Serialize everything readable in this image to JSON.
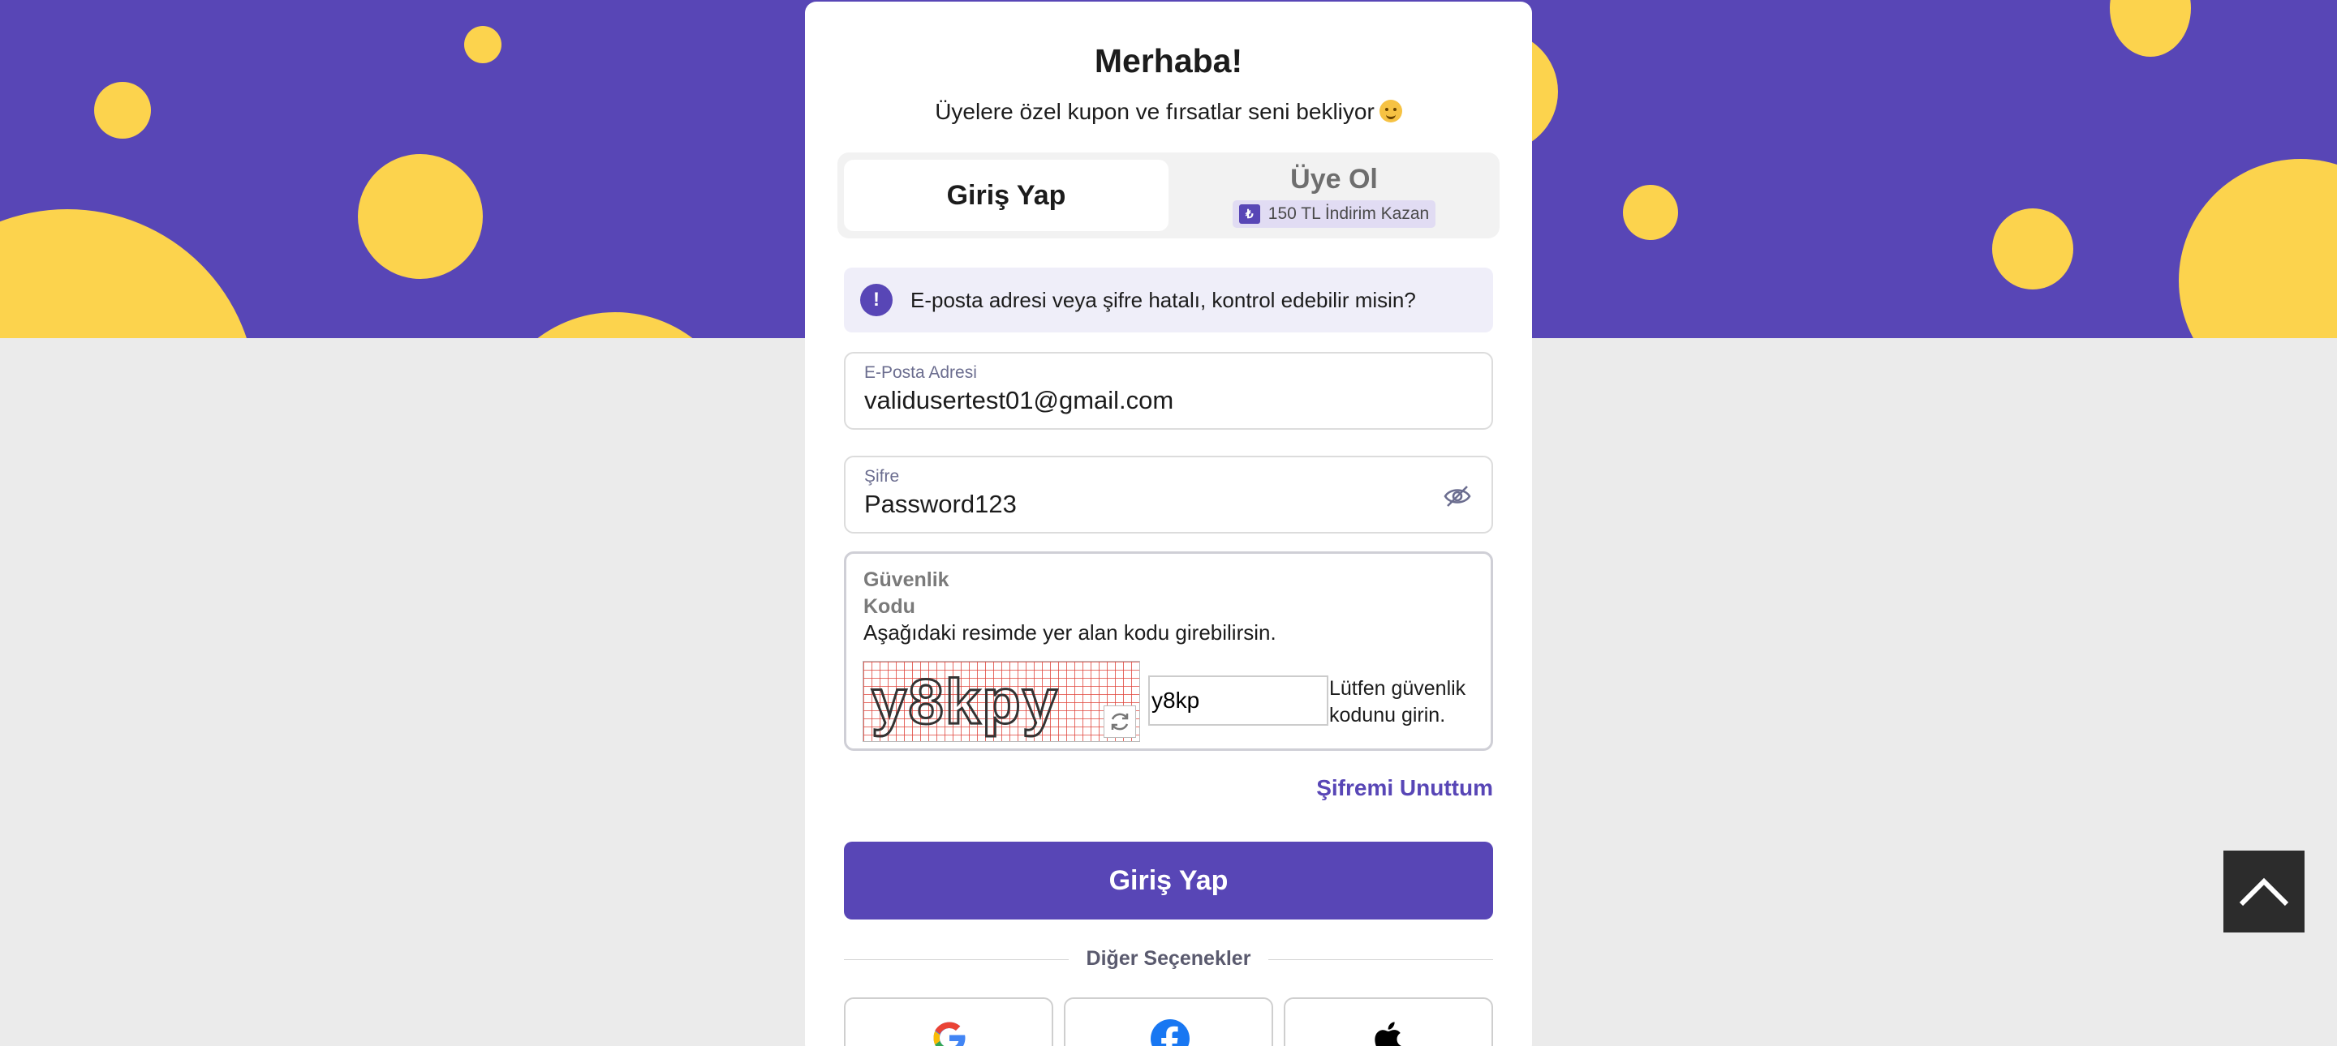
{
  "page": {
    "greeting": "Merhaba!",
    "subtitle": "Üyelere özel kupon ve fırsatlar seni bekliyor"
  },
  "tabs": {
    "login_label": "Giriş Yap",
    "signup_label": "Üye Ol",
    "signup_promo": "150 TL İndirim Kazan",
    "promo_icon_glyph": "₺",
    "active": "login"
  },
  "alert": {
    "icon_glyph": "!",
    "message": "E-posta adresi veya şifre hatalı, kontrol edebilir misin?"
  },
  "email_field": {
    "label": "E-Posta Adresi",
    "value": "validusertest01@gmail.com"
  },
  "password_field": {
    "label": "Şifre",
    "value": "Password123"
  },
  "security": {
    "label": "Güvenlik Kodu",
    "description": "Aşağıdaki resimde yer alan kodu girebilirsin.",
    "captcha_text": "y8kpy",
    "input_value": "y8kp",
    "hint": "Lütfen güvenlik kodunu girin."
  },
  "forgot_password": "Şifremi Unuttum",
  "submit_label": "Giriş Yap",
  "other_options": "Diğer Seçenekler",
  "social": [
    {
      "name": "google",
      "icon": "google-icon"
    },
    {
      "name": "facebook",
      "icon": "facebook-icon"
    },
    {
      "name": "apple",
      "icon": "apple-icon"
    }
  ],
  "colors": {
    "brand": "#5846b6",
    "accent_yellow": "#fcd34d",
    "page_bg": "#ebebeb"
  }
}
